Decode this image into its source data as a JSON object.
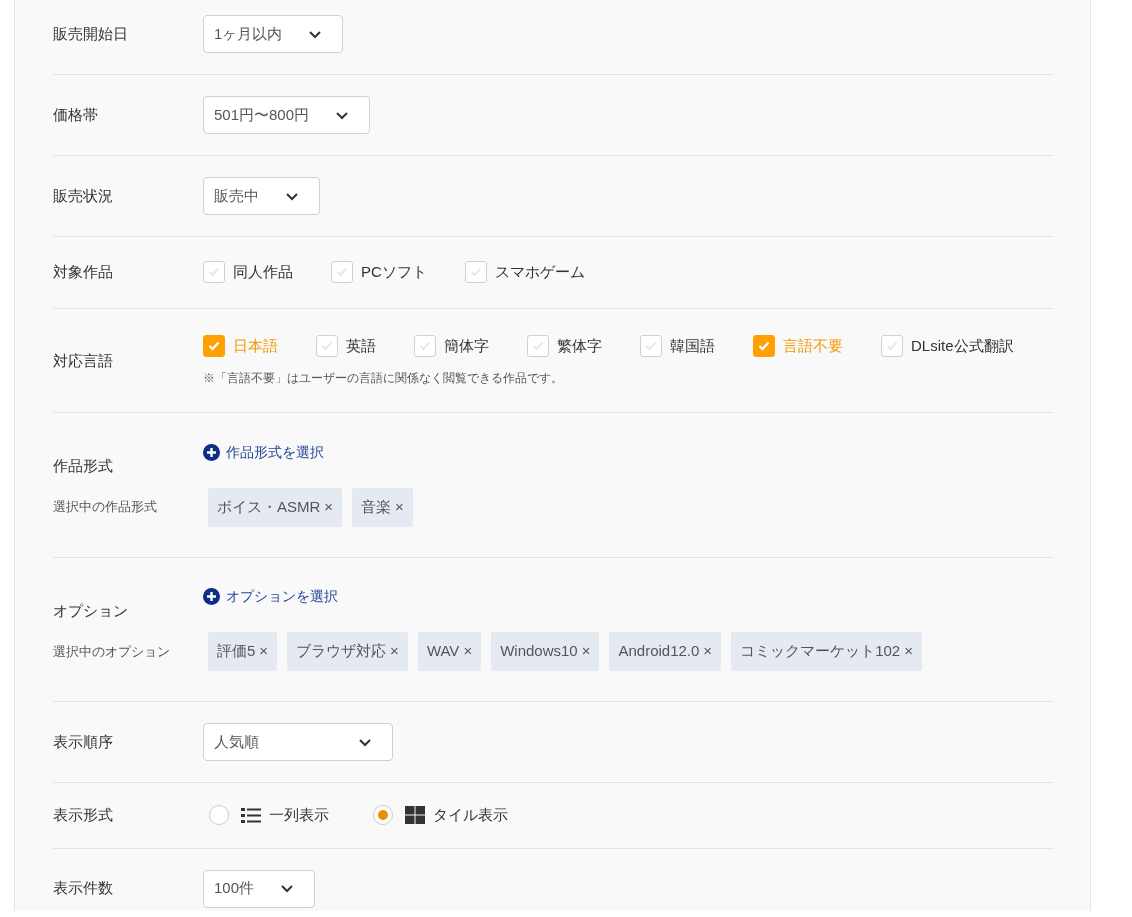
{
  "rows": [
    {
      "kind": "select",
      "label": "販売開始日",
      "value": "1ヶ月以内"
    },
    {
      "kind": "select",
      "label": "価格帯",
      "value": "501円〜800円"
    },
    {
      "kind": "select",
      "label": "販売状況",
      "value": "販売中"
    },
    {
      "kind": "checkboxes",
      "label": "対象作品",
      "options": [
        {
          "label": "同人作品",
          "checked": false
        },
        {
          "label": "PCソフト",
          "checked": false
        },
        {
          "label": "スマホゲーム",
          "checked": false
        }
      ]
    },
    {
      "kind": "checkboxes",
      "label": "対応言語",
      "note": "※「言語不要」はユーザーの言語に関係なく閲覧できる作品です。",
      "options": [
        {
          "label": "日本語",
          "checked": true
        },
        {
          "label": "英語",
          "checked": false
        },
        {
          "label": "簡体字",
          "checked": false
        },
        {
          "label": "繁体字",
          "checked": false
        },
        {
          "label": "韓国語",
          "checked": false
        },
        {
          "label": "言語不要",
          "checked": true
        },
        {
          "label": "DLsite公式翻訳",
          "checked": false
        }
      ]
    },
    {
      "kind": "tags",
      "label": "作品形式",
      "link": "作品形式を選択",
      "sublabel": "選択中の作品形式",
      "tags": [
        {
          "text": "ボイス・ASMR",
          "remove": "×"
        },
        {
          "text": "音楽",
          "remove": "×"
        }
      ]
    },
    {
      "kind": "tags",
      "label": "オプション",
      "link": "オプションを選択",
      "sublabel": "選択中のオプション",
      "tags": [
        {
          "text": "評価5",
          "remove": "×"
        },
        {
          "text": "ブラウザ対応",
          "remove": "×"
        },
        {
          "text": "WAV",
          "remove": "×"
        },
        {
          "text": "Windows10",
          "remove": "×"
        },
        {
          "text": "Android12.0",
          "remove": "×"
        },
        {
          "text": "コミックマーケット102",
          "remove": "×"
        }
      ]
    },
    {
      "kind": "select",
      "label": "表示順序",
      "value": "人気順"
    },
    {
      "kind": "radios",
      "label": "表示形式",
      "options": [
        {
          "label": "一列表示",
          "kind": "list",
          "selected": false
        },
        {
          "label": "タイル表示",
          "kind": "grid",
          "selected": true
        }
      ]
    },
    {
      "kind": "select",
      "label": "表示件数",
      "value": "100件"
    }
  ]
}
